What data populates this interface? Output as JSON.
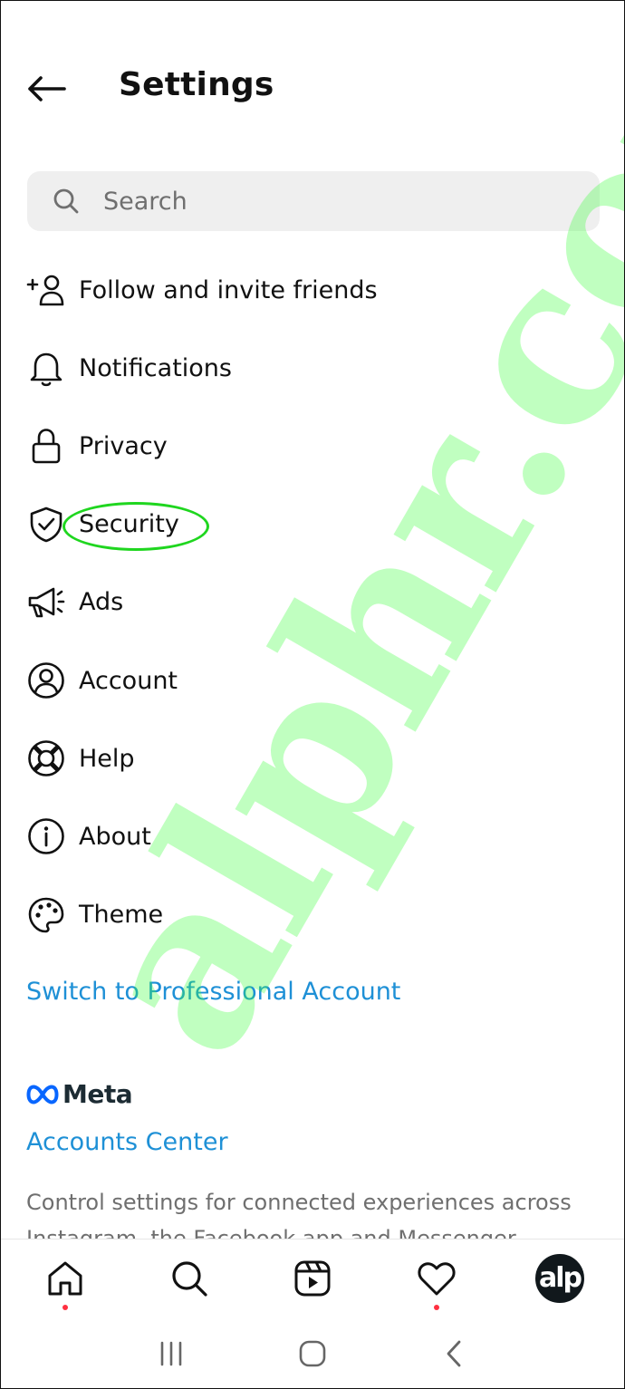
{
  "header": {
    "title": "Settings"
  },
  "search": {
    "placeholder": "Search"
  },
  "menu": {
    "items": [
      {
        "label": "Follow and invite friends",
        "icon": "add-person-icon"
      },
      {
        "label": "Notifications",
        "icon": "bell-icon"
      },
      {
        "label": "Privacy",
        "icon": "lock-icon"
      },
      {
        "label": "Security",
        "icon": "shield-check-icon"
      },
      {
        "label": "Ads",
        "icon": "megaphone-icon"
      },
      {
        "label": "Account",
        "icon": "user-circle-icon"
      },
      {
        "label": "Help",
        "icon": "lifebuoy-icon"
      },
      {
        "label": "About",
        "icon": "info-icon"
      },
      {
        "label": "Theme",
        "icon": "palette-icon"
      }
    ]
  },
  "professional": {
    "label": "Switch to Professional Account"
  },
  "meta": {
    "logo_text": "Meta",
    "accounts_center": "Accounts Center",
    "description": "Control settings for connected experiences across Instagram, the Facebook app and Messenger"
  },
  "bottom_nav": {
    "items": [
      "home-icon",
      "search-icon",
      "reels-icon",
      "heart-icon",
      "profile-avatar"
    ],
    "avatar_text": "alp"
  },
  "system_nav": {
    "items": [
      "recents-icon",
      "home-circle-icon",
      "back-chevron-icon"
    ]
  },
  "watermark": {
    "text": "alphr.com"
  },
  "colors": {
    "link": "#1e90d6",
    "highlight_ring": "#1fd61f",
    "notification_dot": "#ff3040",
    "search_bg": "#efefef"
  }
}
